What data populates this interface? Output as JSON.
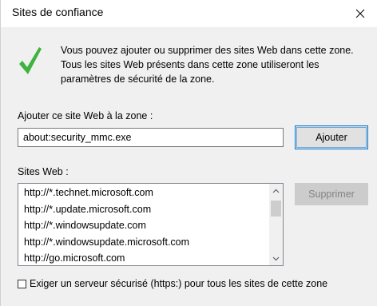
{
  "window": {
    "title": "Sites de confiance"
  },
  "intro": {
    "text": "Vous pouvez ajouter ou supprimer des sites Web dans cette zone. Tous les sites Web présents dans cette zone utiliseront les paramètres de sécurité de la zone."
  },
  "add_site": {
    "label": "Ajouter ce site Web à la zone :",
    "value": "about:security_mmc.exe",
    "button_label": "Ajouter"
  },
  "sites": {
    "label": "Sites Web :",
    "items": [
      "http://*.technet.microsoft.com",
      "http://*.update.microsoft.com",
      "http://*.windowsupdate.com",
      "http://*.windowsupdate.microsoft.com",
      "http://go.microsoft.com"
    ],
    "remove_label": "Supprimer"
  },
  "https_option": {
    "label": "Exiger un serveur sécurisé (https:) pour tous les sites de cette zone",
    "checked": false
  },
  "icons": {
    "check": "check-icon",
    "close": "close-icon"
  },
  "colors": {
    "check_green": "#3fb33f",
    "focus_blue": "#0078d7"
  }
}
